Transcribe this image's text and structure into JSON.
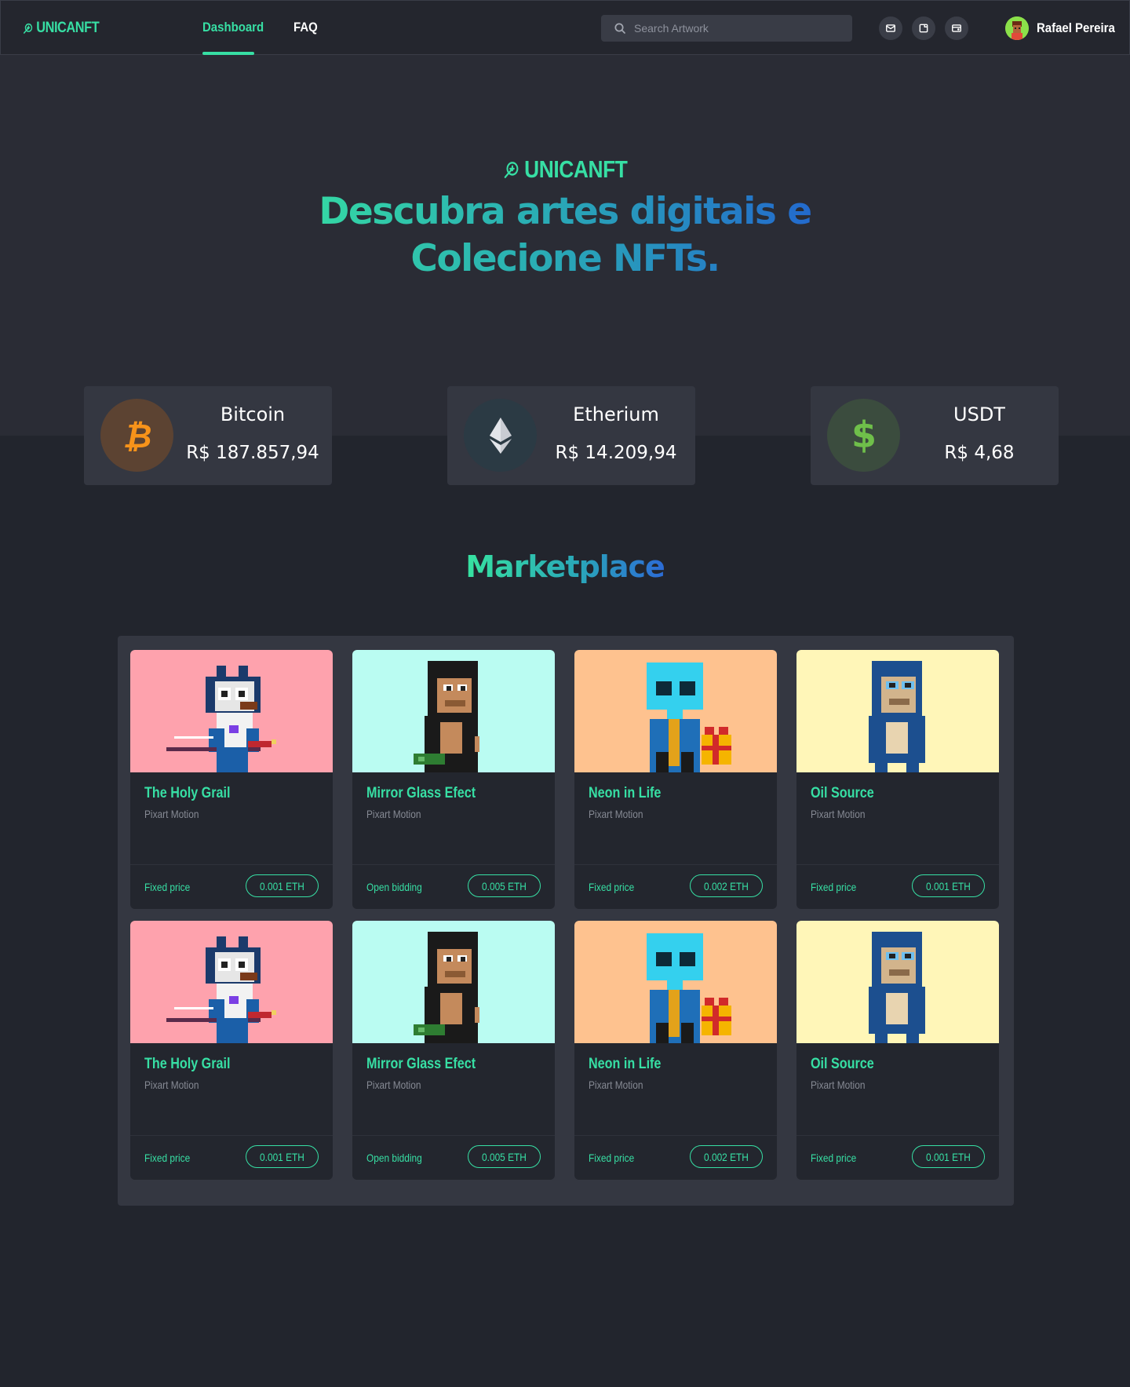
{
  "navbar": {
    "brand": "UNICANFT",
    "links": [
      {
        "label": "Dashboard",
        "active": true
      },
      {
        "label": "FAQ",
        "active": false
      }
    ],
    "search_placeholder": "Search Artwork",
    "icons": [
      "mail-icon",
      "note-icon",
      "wallet-icon"
    ],
    "user_name": "Rafael Pereira"
  },
  "hero": {
    "brand": "UNICANFT",
    "title_line1": "Descubra artes digitais e",
    "title_line2": "Colecione NFTs."
  },
  "cryptos": [
    {
      "name": "Bitcoin",
      "price": "R$ 187.857,94",
      "icon": "bitcoin-icon",
      "color": "#f7931a"
    },
    {
      "name": "Etherium",
      "price": "R$ 14.209,94",
      "icon": "ethereum-icon",
      "color": "#c9ccd3"
    },
    {
      "name": "USDT",
      "price": "R$ 4,68",
      "icon": "dollar-icon",
      "color": "#6fbf4a"
    }
  ],
  "marketplace": {
    "title": "Marketplace",
    "items": [
      {
        "title": "The Holy Grail",
        "artist": "Pixart Motion",
        "sale_type": "Fixed price",
        "price": "0.001 ETH",
        "bg": "#fea2ad",
        "art": "cat"
      },
      {
        "title": "Mirror Glass Efect",
        "artist": "Pixart Motion",
        "sale_type": "Open bidding",
        "price": "0.005 ETH",
        "bg": "#bafcf2",
        "art": "ape"
      },
      {
        "title": "Neon in Life",
        "artist": "Pixart Motion",
        "sale_type": "Fixed price",
        "price": "0.002 ETH",
        "bg": "#fec28f",
        "art": "alien"
      },
      {
        "title": "Oil Source",
        "artist": "Pixart Motion",
        "sale_type": "Fixed price",
        "price": "0.001 ETH",
        "bg": "#fff6b8",
        "art": "blueape"
      },
      {
        "title": "The Holy Grail",
        "artist": "Pixart Motion",
        "sale_type": "Fixed price",
        "price": "0.001 ETH",
        "bg": "#fea2ad",
        "art": "cat"
      },
      {
        "title": "Mirror Glass Efect",
        "artist": "Pixart Motion",
        "sale_type": "Open bidding",
        "price": "0.005 ETH",
        "bg": "#bafcf2",
        "art": "ape"
      },
      {
        "title": "Neon in Life",
        "artist": "Pixart Motion",
        "sale_type": "Fixed price",
        "price": "0.002 ETH",
        "bg": "#fec28f",
        "art": "alien"
      },
      {
        "title": "Oil Source",
        "artist": "Pixart Motion",
        "sale_type": "Fixed price",
        "price": "0.001 ETH",
        "bg": "#fff6b8",
        "art": "blueape"
      }
    ]
  },
  "colors": {
    "accent": "#37dfa4",
    "background": "#22252d",
    "card": "#343741"
  }
}
